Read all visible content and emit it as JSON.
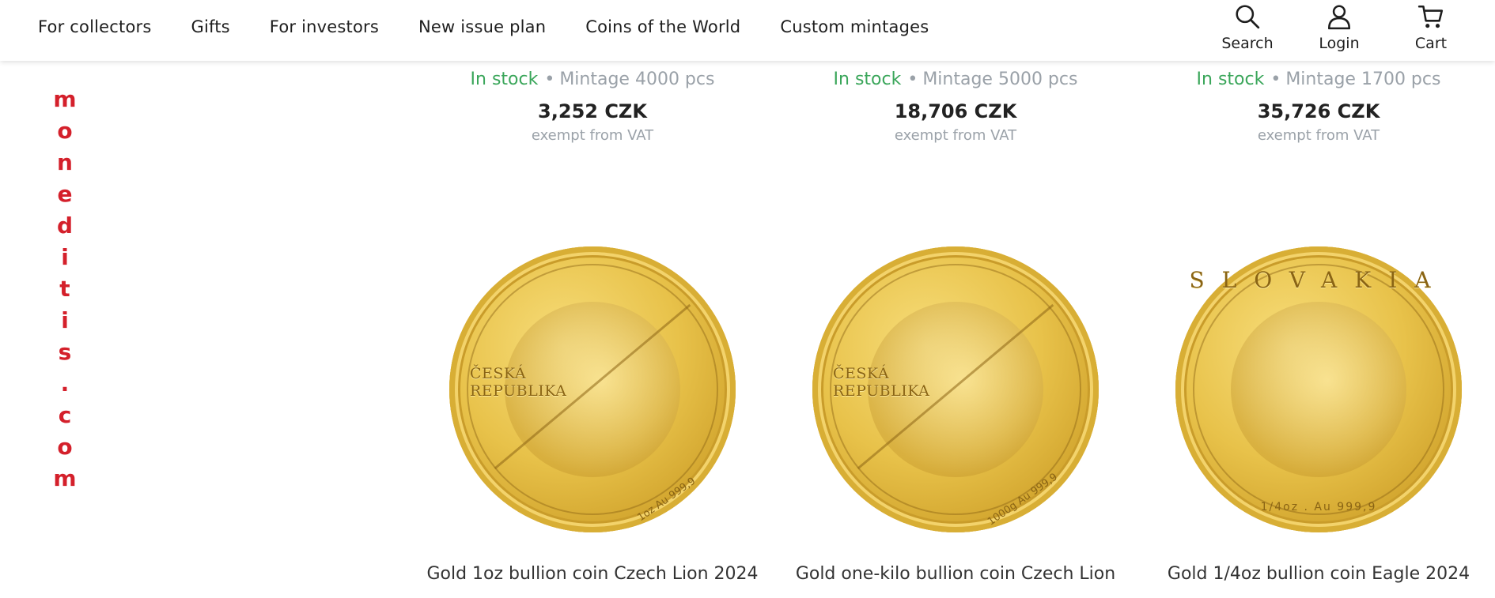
{
  "nav": {
    "items": [
      {
        "label": "For collectors"
      },
      {
        "label": "Gifts"
      },
      {
        "label": "For investors"
      },
      {
        "label": "New issue plan"
      },
      {
        "label": "Coins of the World"
      },
      {
        "label": "Custom mintages"
      }
    ]
  },
  "header_actions": {
    "search": {
      "label": "Search",
      "icon": "search-icon"
    },
    "login": {
      "label": "Login",
      "icon": "user-icon"
    },
    "cart": {
      "label": "Cart",
      "icon": "cart-icon"
    }
  },
  "logo": {
    "letters": [
      "m",
      "o",
      "n",
      "e",
      "d",
      "i",
      "t",
      "i",
      "s",
      ".",
      "c",
      "o",
      "m"
    ]
  },
  "colors": {
    "stock": "#3aa65a",
    "muted": "#9aa1a8",
    "logo_red": "#d4202b"
  },
  "products_top": [
    {
      "stock": "In stock",
      "mintage": "Mintage 4000 pcs",
      "price": "3,252 CZK",
      "vat": "exempt from VAT"
    },
    {
      "stock": "In stock",
      "mintage": "Mintage 5000 pcs",
      "price": "18,706 CZK",
      "vat": "exempt from VAT"
    },
    {
      "stock": "In stock",
      "mintage": "Mintage 1700 pcs",
      "price": "35,726 CZK",
      "vat": "exempt from VAT"
    }
  ],
  "products_bottom": [
    {
      "name": "Gold 1oz bullion coin Czech Lion 2024",
      "coin_text": "ČESKÁ REPUBLIKA",
      "coin_fine": "1oz Au 999,9"
    },
    {
      "name": "Gold one-kilo bullion coin Czech Lion",
      "coin_text": "ČESKÁ REPUBLIKA",
      "coin_fine": "1000g Au 999,9"
    },
    {
      "name": "Gold 1/4oz bullion coin Eagle 2024",
      "coin_text": "SLOVAKIA",
      "coin_fine": "1/4oz . Au 999,9"
    }
  ]
}
